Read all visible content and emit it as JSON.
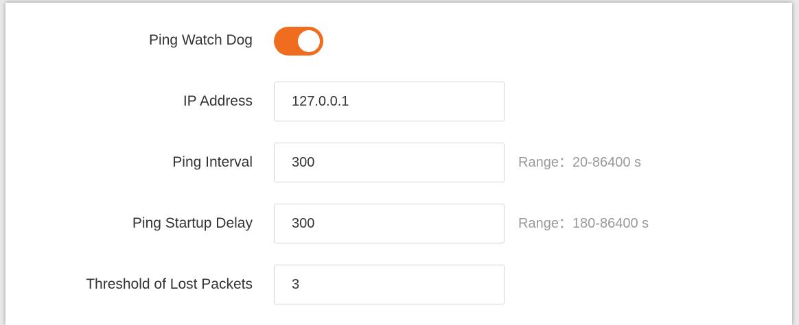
{
  "colors": {
    "accent": "#f06d1f",
    "label_text": "#333333",
    "hint_text": "#999999",
    "input_border": "#d4d4d4"
  },
  "ping_watchdog": {
    "label": "Ping Watch Dog",
    "enabled": true
  },
  "ip_address": {
    "label": "IP Address",
    "value": "127.0.0.1"
  },
  "ping_interval": {
    "label": "Ping Interval",
    "value": "300",
    "hint": "Range：20-86400 s"
  },
  "ping_startup_delay": {
    "label": "Ping Startup Delay",
    "value": "300",
    "hint": "Range：180-86400 s"
  },
  "lost_packets_threshold": {
    "label": "Threshold of Lost Packets",
    "value": "3"
  }
}
